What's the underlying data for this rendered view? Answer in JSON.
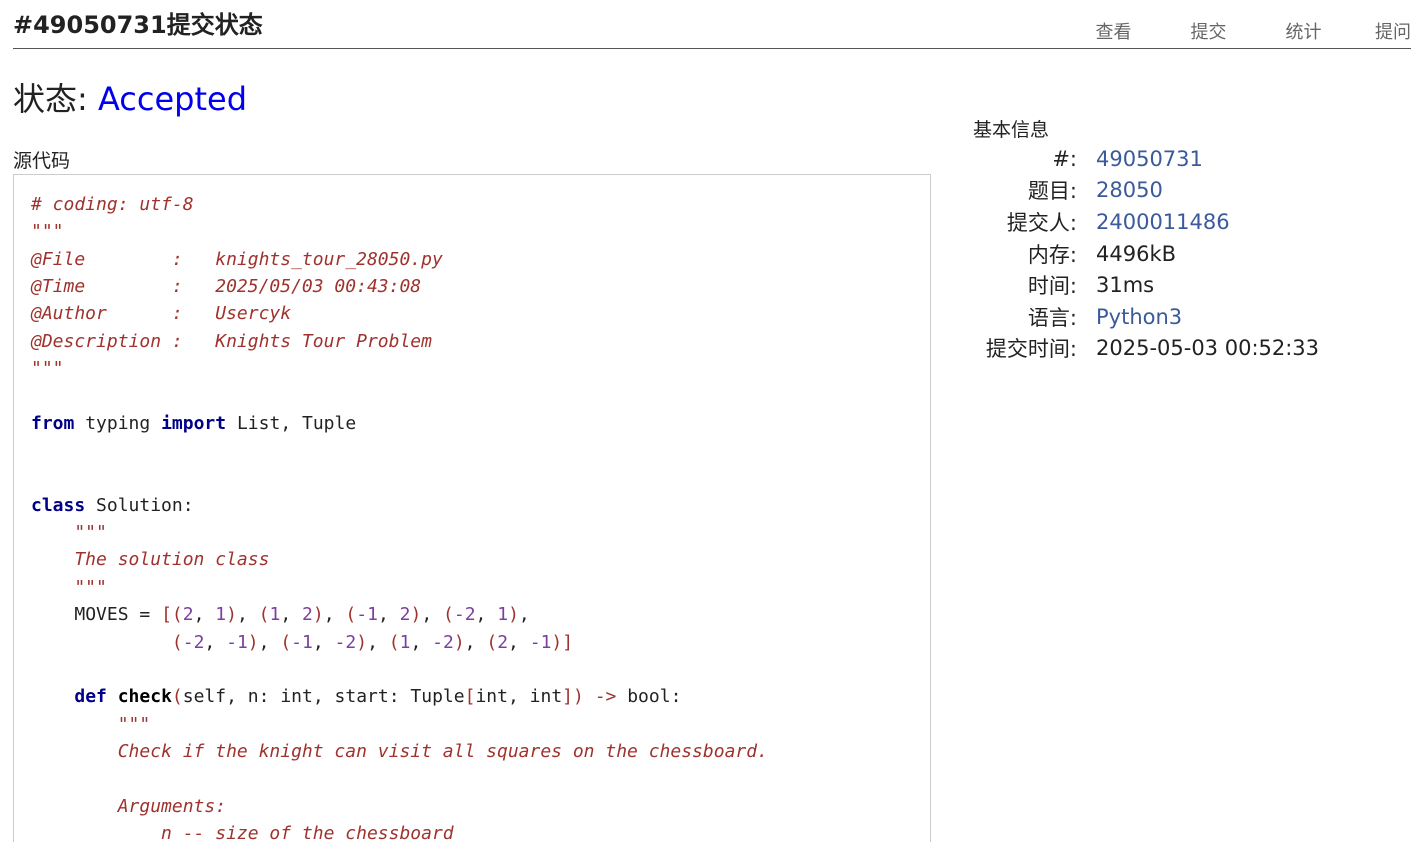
{
  "header": {
    "title": "#49050731提交状态",
    "nav": [
      "查看",
      "提交",
      "统计",
      "提问"
    ]
  },
  "status": {
    "label": "状态:",
    "value": "Accepted",
    "value_color": "#0000ee"
  },
  "source": {
    "label": "源代码",
    "language": "python",
    "lines": [
      "# coding: utf-8",
      "\"\"\"",
      "@File        :   knights_tour_28050.py",
      "@Time        :   2025/05/03 00:43:08",
      "@Author      :   Usercyk",
      "@Description :   Knights Tour Problem",
      "\"\"\"",
      "",
      "from typing import List, Tuple",
      "",
      "",
      "class Solution:",
      "    \"\"\"",
      "    The solution class",
      "    \"\"\"",
      "    MOVES = [(2, 1), (1, 2), (-1, 2), (-2, 1),",
      "             (-2, -1), (-1, -2), (1, -2), (2, -1)]",
      "",
      "    def check(self, n: int, start: Tuple[int, int]) -> bool:",
      "        \"\"\"",
      "        Check if the knight can visit all squares on the chessboard.",
      "",
      "        Arguments:",
      "            n -- size of the chessboard"
    ]
  },
  "info": {
    "title": "基本信息",
    "rows": [
      {
        "label": "#:",
        "value": "49050731",
        "link": true
      },
      {
        "label": "题目:",
        "value": "28050",
        "link": true
      },
      {
        "label": "提交人:",
        "value": "2400011486",
        "link": true
      },
      {
        "label": "内存:",
        "value": "4496kB",
        "link": false
      },
      {
        "label": "时间:",
        "value": "31ms",
        "link": false
      },
      {
        "label": "语言:",
        "value": "Python3",
        "link": true
      },
      {
        "label": "提交时间:",
        "value": "2025-05-03 00:52:33",
        "link": false
      }
    ]
  },
  "colors": {
    "link": "#3a5a9a",
    "accepted": "#0000ee",
    "comment": "#a0322d",
    "keyword": "#000088",
    "number": "#7b3fa0"
  }
}
